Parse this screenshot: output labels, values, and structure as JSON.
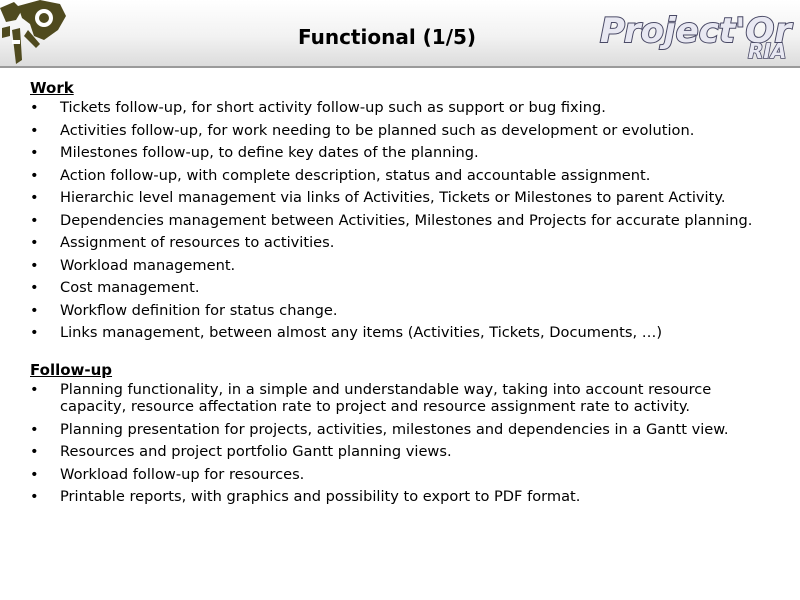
{
  "header": {
    "title": "Functional (1/5)",
    "logo_text": "Project'Or",
    "logo_badge": "RIA"
  },
  "sections": [
    {
      "heading": "Work",
      "items": [
        "Tickets follow-up, for short activity follow-up such as support or bug fixing.",
        "Activities follow-up, for work needing to be planned such as development or evolution.",
        "Milestones follow-up, to define key dates of the planning.",
        "Action follow-up, with complete description, status and accountable assignment.",
        "Hierarchic level management via links of Activities, Tickets or Milestones to parent Activity.",
        "Dependencies management between Activities, Milestones and Projects for accurate planning.",
        "Assignment of resources to activities.",
        "Workload management.",
        "Cost management.",
        "Workflow definition for status change.",
        "Links management, between almost any items (Activities, Tickets, Documents, …)"
      ]
    },
    {
      "heading": "Follow-up",
      "items": [
        "Planning functionality, in a simple and understandable way, taking into account resource capacity, resource affectation rate to project and resource assignment rate to activity.",
        "Planning presentation for projects, activities, milestones and dependencies in a Gantt view.",
        "Resources and project portfolio Gantt planning views.",
        "Workload follow-up for resources.",
        "Printable reports, with graphics and possibility to export to PDF format."
      ]
    }
  ],
  "bullet_glyph": "•",
  "colors": {
    "logo_olive": "#4f4a1e",
    "logo_text_fill": "#e8e8f2",
    "logo_text_stroke": "#4a4a66",
    "header_rule": "#9a9a9a"
  }
}
